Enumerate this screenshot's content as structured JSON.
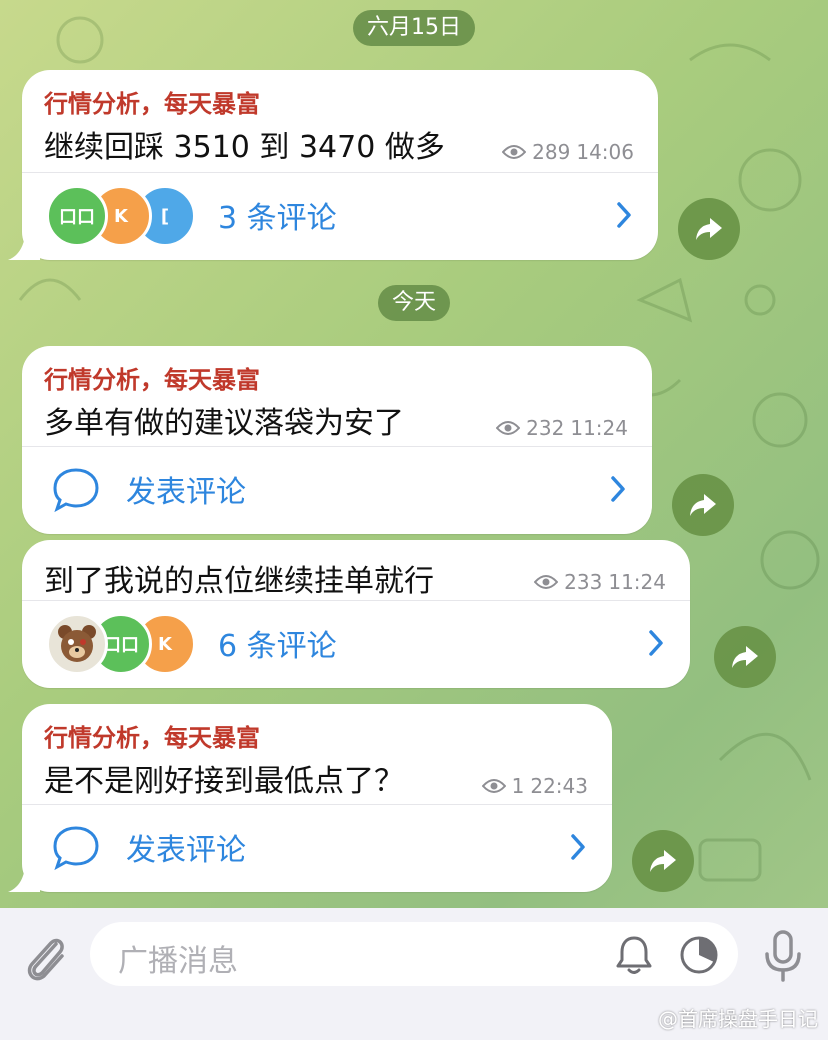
{
  "dates": {
    "first": "六月15日",
    "second": "今天"
  },
  "messages": [
    {
      "sender": "行情分析，每天暴富",
      "text": "继续回踩 3510 到 3470 做多",
      "views": "289",
      "time": "14:06",
      "comments": {
        "label": "3 条评论",
        "avatars": [
          "口口",
          "K",
          "["
        ]
      }
    },
    {
      "sender": "行情分析，每天暴富",
      "text": "多单有做的建议落袋为安了",
      "views": "232",
      "time": "11:24",
      "comments": {
        "label": "发表评论"
      }
    },
    {
      "text": "到了我说的点位继续挂单就行",
      "views": "233",
      "time": "11:24",
      "comments": {
        "label": "6 条评论",
        "avatars": [
          "bear",
          "口口",
          "K"
        ]
      }
    },
    {
      "sender": "行情分析，每天暴富",
      "text": "是不是刚好接到最低点了？",
      "views": "1",
      "time": "22:43",
      "comments": {
        "label": "发表评论"
      }
    }
  ],
  "input": {
    "placeholder": "广播消息"
  },
  "icons": {
    "attach": "paperclip-icon",
    "bell": "bell-icon",
    "timer": "timer-icon",
    "mic": "microphone-icon",
    "share": "share-forward-icon",
    "eye": "eye-icon",
    "comment": "speech-bubble-icon",
    "chevron": "chevron-right-icon"
  },
  "colors": {
    "sender": "#c0392b",
    "link": "#2e86de",
    "meta": "#8e8e93"
  },
  "watermark": "@首席操盘手日记"
}
